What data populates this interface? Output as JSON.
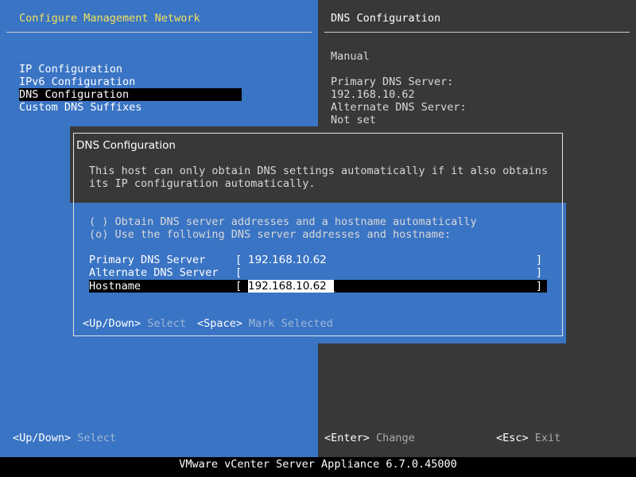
{
  "left_panel": {
    "title": "Configure Management Network",
    "menu": [
      {
        "label": "IP Configuration"
      },
      {
        "label": "IPv6 Configuration"
      },
      {
        "label": "DNS Configuration"
      },
      {
        "label": "Custom DNS Suffixes"
      }
    ],
    "footer_key": "<Up/Down>",
    "footer_action": "Select"
  },
  "right_panel": {
    "title": "DNS Configuration",
    "mode": "Manual",
    "primary_label": "Primary DNS Server:",
    "primary_value": "192.168.10.62",
    "alternate_label": "Alternate DNS Server:",
    "alternate_value": "Not set",
    "enter_key": "<Enter>",
    "enter_action": "Change",
    "esc_key": "<Esc>",
    "esc_action": "Exit"
  },
  "dialog": {
    "title": "DNS Configuration",
    "description_line1": "This host can only obtain DNS settings automatically if it also obtains",
    "description_line2": "its IP configuration automatically.",
    "option_auto": "( ) Obtain DNS server addresses and a hostname automatically",
    "option_manual": "(o) Use the following DNS server addresses and hostname:",
    "fields": [
      {
        "label": "Primary DNS Server",
        "value": "192.168.10.62"
      },
      {
        "label": "Alternate DNS Server",
        "value": ""
      },
      {
        "label": "Hostname",
        "value": "192.168.10.62"
      }
    ],
    "bracket_open": "[",
    "bracket_close": "]",
    "hint_key1": "<Up/Down>",
    "hint_action1": "Select",
    "hint_key2": "<Space>",
    "hint_action2": "Mark Selected"
  },
  "status_bar": {
    "text": "VMware vCenter Server Appliance 6.7.0.45000"
  }
}
